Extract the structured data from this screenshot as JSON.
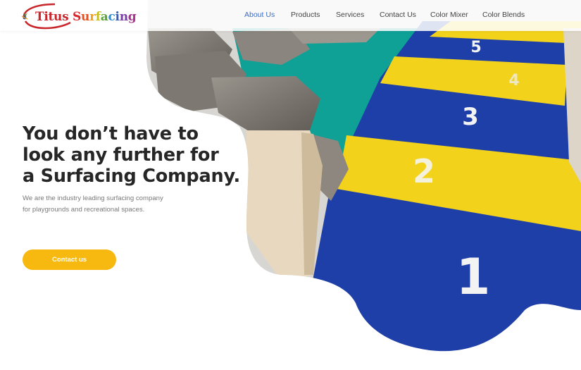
{
  "header": {
    "logo": {
      "word1": "Titus",
      "word2_letters": [
        "S",
        "u",
        "r",
        "f",
        "a",
        "c",
        "i",
        "n",
        "g"
      ],
      "word2_colors": [
        "#d9262c",
        "#e8501f",
        "#f0a31a",
        "#c9c014",
        "#5aa23a",
        "#2f8fd0",
        "#3a5bb5",
        "#7a3fa6",
        "#a8348f"
      ]
    },
    "nav": [
      {
        "label": "About Us",
        "active": true
      },
      {
        "label": "Products",
        "active": false
      },
      {
        "label": "Services",
        "active": false
      },
      {
        "label": "Contact Us",
        "active": false
      },
      {
        "label": "Color Mixer",
        "active": false
      },
      {
        "label": "Color Blends",
        "active": false
      }
    ]
  },
  "hero": {
    "headline": [
      "You don’t have to",
      "look any further for",
      "a Surfacing Company."
    ],
    "subcopy": [
      "We are the industry leading surfacing company",
      "for playgrounds and recreational spaces."
    ],
    "cta_label": "Contact us",
    "hopscotch_numbers": [
      "5",
      "4",
      "3",
      "2",
      "1"
    ]
  },
  "colors": {
    "accent": "#f7b810",
    "active_nav": "#3d6dbf",
    "heading": "#262626",
    "track_blue": "#1e3fa8",
    "track_yellow": "#f2d21a",
    "turf_teal": "#0f9f94"
  }
}
